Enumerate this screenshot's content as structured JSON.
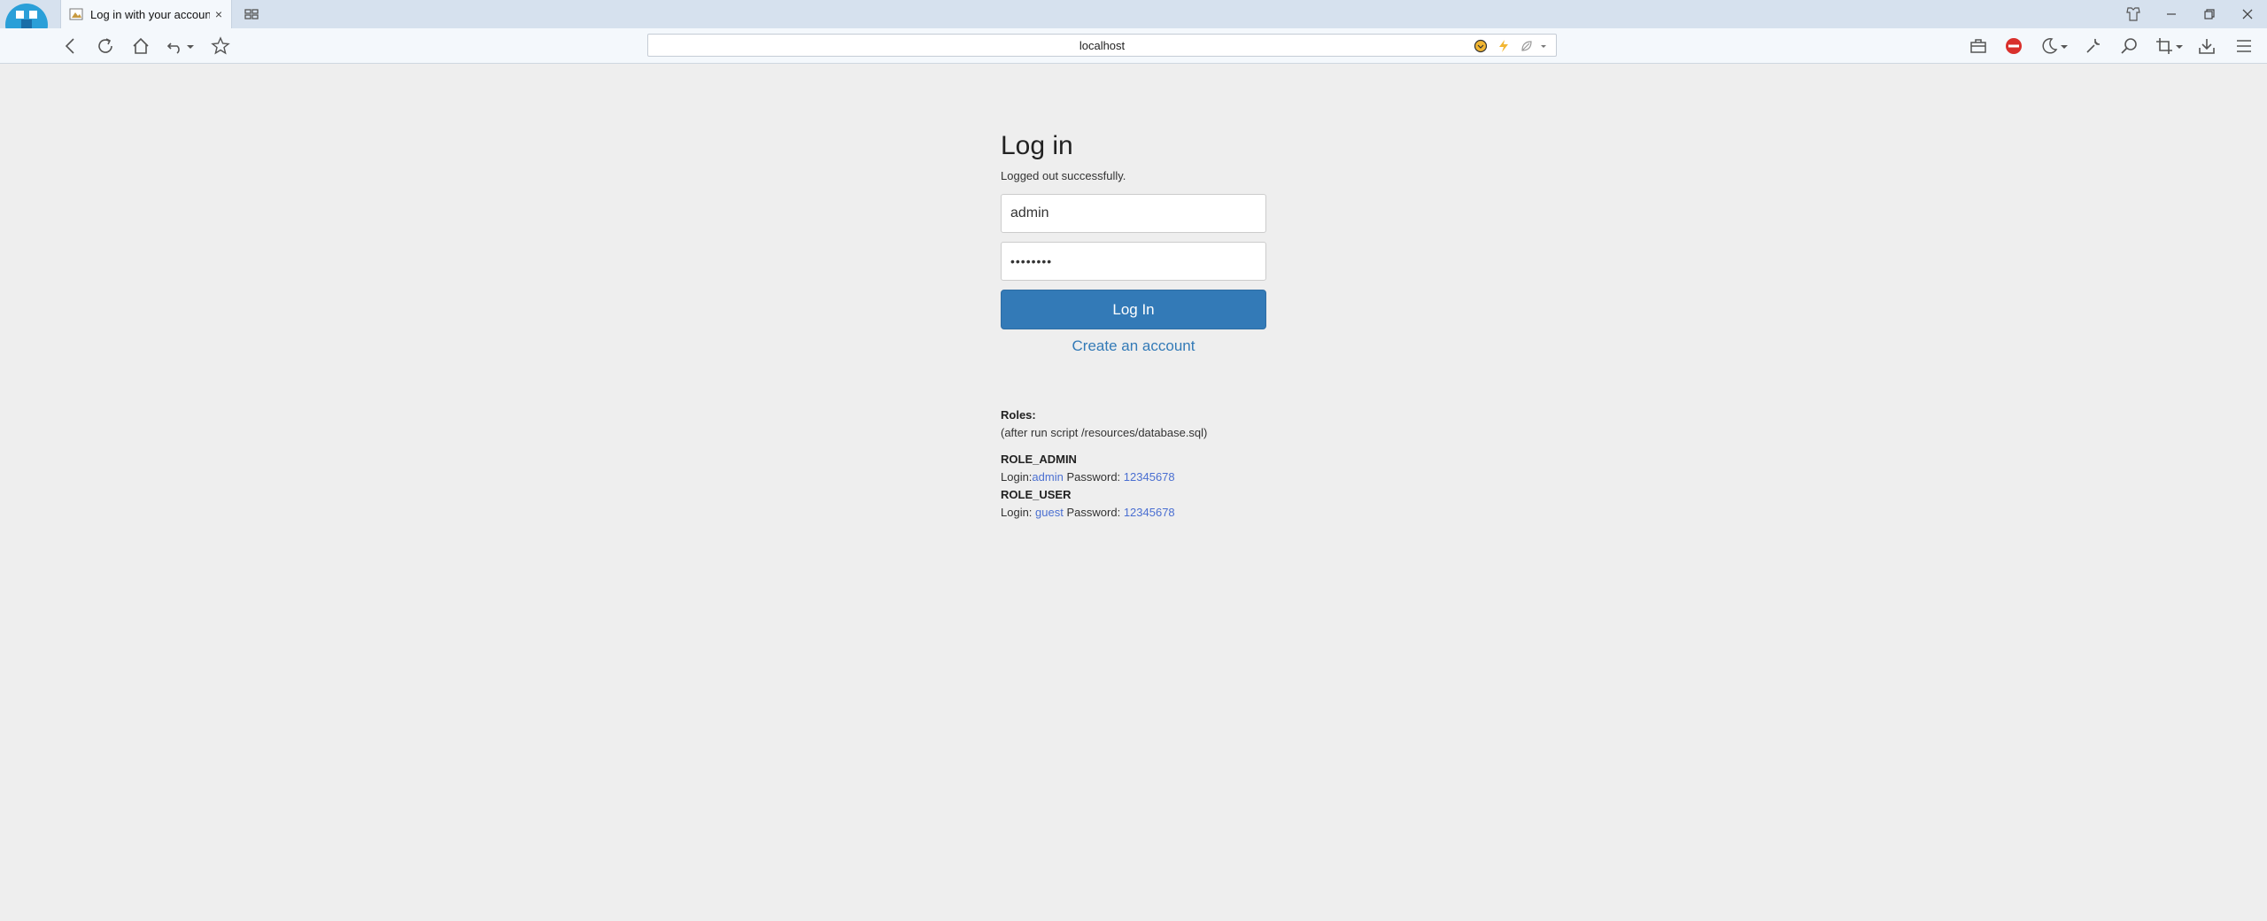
{
  "browser": {
    "tab_title": "Log in with your account",
    "tab_close": "×",
    "url": "localhost",
    "icons": [
      "app-logo-icon",
      "tab-favicon",
      "tab-grid-icon",
      "back-icon",
      "reload-icon",
      "home-icon",
      "undo-icon",
      "bookmark-star-icon",
      "shield-ext-icon",
      "lightning-ext-icon",
      "leaf-ext-icon",
      "url-dropdown-icon",
      "toolbox-icon",
      "adblock-icon",
      "moon-icon",
      "wrench-icon",
      "search-zoom-icon",
      "crop-icon",
      "download-icon",
      "menu-icon",
      "minimize-icon",
      "restore-icon",
      "close-window-icon",
      "clothes-icon"
    ]
  },
  "login": {
    "heading": "Log in",
    "message": "Logged out successfully.",
    "username_value": "admin",
    "password_value": "••••••••",
    "submit_label": "Log In",
    "create_link": "Create an account"
  },
  "roles": {
    "title": "Roles:",
    "note": "(after run script /resources/database.sql)",
    "items": [
      {
        "name": "ROLE_ADMIN",
        "login_label": "Login:",
        "login": "admin",
        "password_label": "Password:",
        "password": "12345678"
      },
      {
        "name": "ROLE_USER",
        "login_label": "Login:",
        "login": "guest",
        "password_label": "Password:",
        "password": "12345678"
      }
    ]
  },
  "colors": {
    "primary": "#337ab7",
    "link": "#4a6fd1",
    "page_bg": "#eeeeee",
    "chrome": "#d6e1ee"
  }
}
